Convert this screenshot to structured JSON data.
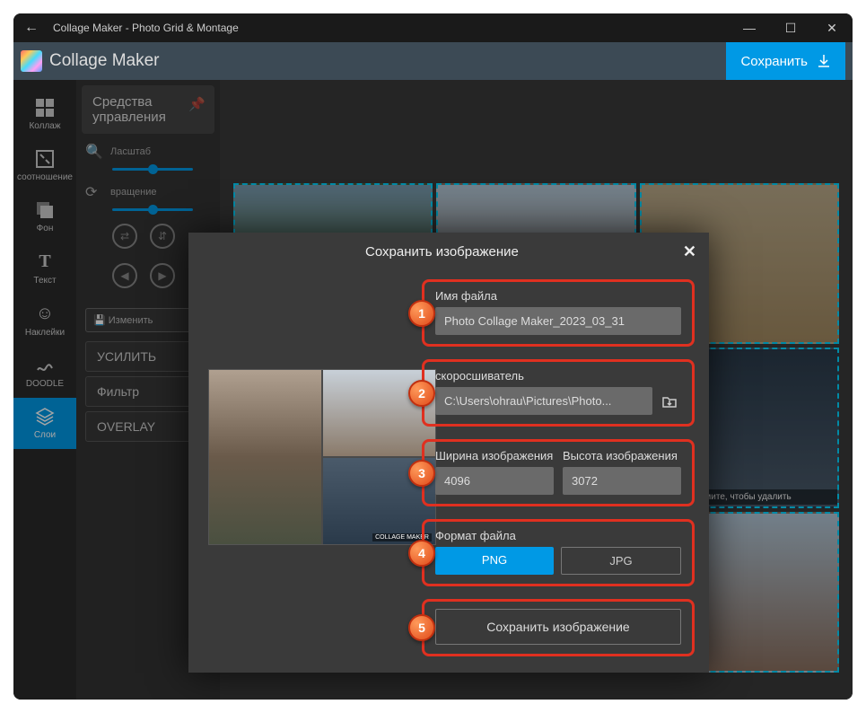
{
  "window": {
    "title": "Collage Maker - Photo Grid & Montage"
  },
  "appbar": {
    "title": "Collage Maker",
    "save": "Сохранить"
  },
  "sidebar": {
    "items": [
      {
        "label": "Коллаж"
      },
      {
        "label": "соотношение"
      },
      {
        "label": "Фон"
      },
      {
        "label": "Текст"
      },
      {
        "label": "Наклейки"
      },
      {
        "label": "DOODLE"
      },
      {
        "label": "Слои"
      }
    ]
  },
  "panel": {
    "head": "Средства управления",
    "zoom": "Ласштаб",
    "rotate": "вращение",
    "edit": "Изменить",
    "enhance": "УСИЛИТЬ",
    "filter": "Фильтр",
    "overlay": "OVERLAY"
  },
  "collage": {
    "watermark": "COLLAGE MAKER",
    "remove_caption": "Нажмите, чтобы удалить"
  },
  "modal": {
    "title": "Сохранить изображение",
    "fname_label": "Имя файла",
    "fname_value": "Photo Collage Maker_2023_03_31",
    "folder_label": "скоросшиватель",
    "folder_value": "C:\\Users\\ohrau\\Pictures\\Photo...",
    "width_label": "Ширина изображения",
    "width_value": "4096",
    "height_label": "Высота изображения",
    "height_value": "3072",
    "format_label": "Формат файла",
    "png": "PNG",
    "jpg": "JPG",
    "save": "Сохранить изображение",
    "badges": {
      "b1": "1",
      "b2": "2",
      "b3": "3",
      "b4": "4",
      "b5": "5"
    }
  }
}
